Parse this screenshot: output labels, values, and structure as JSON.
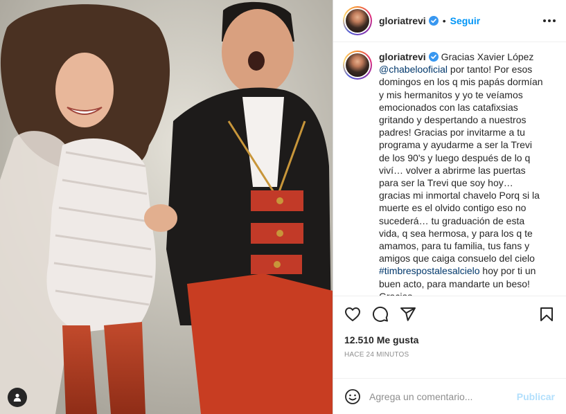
{
  "post": {
    "username": "gloriatrevi",
    "follow_label": "Seguir",
    "separator": "•",
    "caption": {
      "username": "gloriatrevi",
      "part1": " Gracias Xavier López ",
      "mention": "@chabelooficial",
      "part2": " por tanto! Por esos domingos en los q mis papás dormían y mis hermanitos y yo te veíamos emocionados con las catafixsias gritando y despertando a nuestros padres! Gracias por invitarme a tu programa y ayudarme a ser la Trevi de los 90's y luego después de lo q viví… volver a abrirme las puertas para ser la Trevi que soy hoy… gracias mi inmortal chavelo Porq si la muerte es el olvido contigo eso no sucederá… tu graduación de esta vida, q sea hermosa, y para los q te amamos, para tu familia, tus fans y amigos que caiga consuelo del cielo ",
      "hashtag": "#timbrespostalesalcielo",
      "part3": " hoy por ti un buen acto, para mandarte un beso! Gracias"
    },
    "likes": "12.510 Me gusta",
    "timestamp": "HACE 24 MINUTOS",
    "comment_placeholder": "Agrega un comentario...",
    "publish_label": "Publicar"
  },
  "icons": {
    "verified": "verified-badge-icon",
    "more": "more-options-icon",
    "like": "heart-icon",
    "comment": "comment-icon",
    "share": "share-icon",
    "save": "bookmark-icon",
    "emoji": "emoji-icon",
    "tags": "user-tag-icon"
  },
  "colors": {
    "accent": "#0095f6",
    "publish_disabled": "#b2dffc",
    "hashtag": "#00376b",
    "text": "#262626",
    "muted": "#8e8e8e"
  }
}
